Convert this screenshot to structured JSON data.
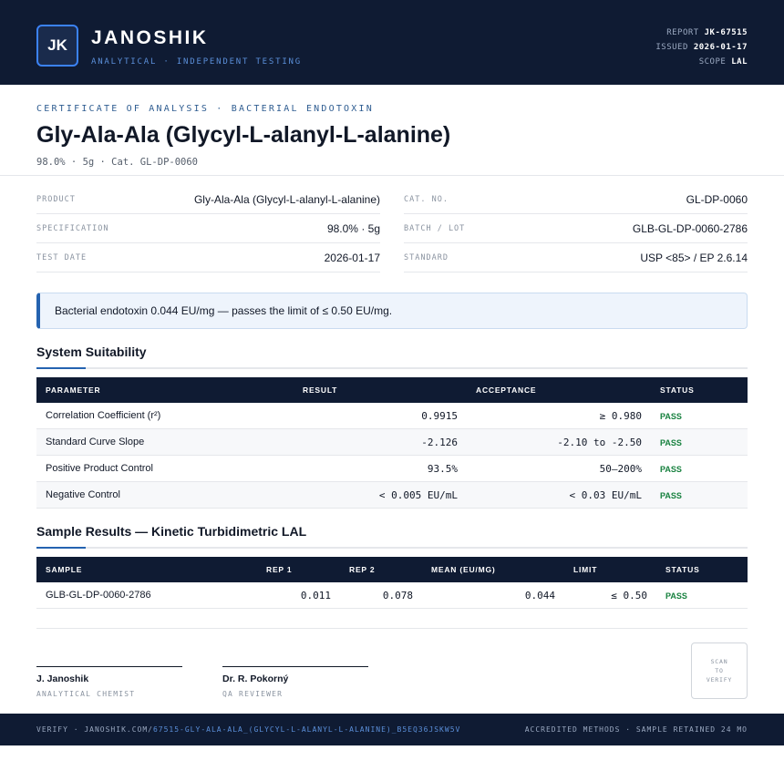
{
  "header": {
    "logo_initials": "JK",
    "brand": "JANOSHIK",
    "tagline": "ANALYTICAL · INDEPENDENT TESTING",
    "report_label": "REPORT",
    "report_value": "JK-67515",
    "issued_label": "ISSUED",
    "issued_value": "2026-01-17",
    "scope_label": "SCOPE",
    "scope_value": "LAL"
  },
  "title_block": {
    "eyebrow": "CERTIFICATE OF ANALYSIS · BACTERIAL ENDOTOXIN",
    "title": "Gly-Ala-Ala (Glycyl-L-alanyl-L-alanine)",
    "subline": "98.0% · 5g  ·  Cat. GL-DP-0060"
  },
  "info": {
    "left": [
      {
        "label": "PRODUCT",
        "value": "Gly-Ala-Ala (Glycyl-L-alanyl-L-alanine)"
      },
      {
        "label": "SPECIFICATION",
        "value": "98.0% · 5g"
      },
      {
        "label": "TEST DATE",
        "value": "2026-01-17"
      }
    ],
    "right": [
      {
        "label": "CAT. NO.",
        "value": "GL-DP-0060"
      },
      {
        "label": "BATCH / LOT",
        "value": "GLB-GL-DP-0060-2786"
      },
      {
        "label": "STANDARD",
        "value": "USP <85> / EP 2.6.14"
      }
    ]
  },
  "callout": {
    "text": "Bacterial endotoxin 0.044 EU/mg — passes the limit of ≤ 0.50 EU/mg."
  },
  "system_suitability": {
    "title": "System Suitability",
    "columns": [
      "PARAMETER",
      "RESULT",
      "ACCEPTANCE",
      "STATUS"
    ],
    "rows": [
      {
        "parameter": "Correlation Coefficient (r²)",
        "result": "0.9915",
        "acceptance": "≥ 0.980",
        "status": "PASS"
      },
      {
        "parameter": "Standard Curve Slope",
        "result": "-2.126",
        "acceptance": "-2.10 to -2.50",
        "status": "PASS"
      },
      {
        "parameter": "Positive Product Control",
        "result": "93.5%",
        "acceptance": "50–200%",
        "status": "PASS"
      },
      {
        "parameter": "Negative Control",
        "result": "< 0.005 EU/mL",
        "acceptance": "< 0.03 EU/mL",
        "status": "PASS"
      }
    ]
  },
  "sample_results": {
    "title": "Sample Results — Kinetic Turbidimetric LAL",
    "columns": [
      "SAMPLE",
      "REP 1",
      "REP 2",
      "MEAN (EU/MG)",
      "LIMIT",
      "STATUS"
    ],
    "rows": [
      {
        "sample": "GLB-GL-DP-0060-2786",
        "rep1": "0.011",
        "rep2": "0.078",
        "mean": "0.044",
        "limit": "≤ 0.50",
        "status": "PASS"
      }
    ]
  },
  "signatures": [
    {
      "name": "J. Janoshik",
      "role": "ANALYTICAL CHEMIST"
    },
    {
      "name": "Dr. R. Pokorný",
      "role": "QA REVIEWER"
    }
  ],
  "qr": {
    "line1": "SCAN",
    "line2": "TO",
    "line3": "VERIFY"
  },
  "footer": {
    "verify_prefix": "VERIFY · JANOSHIK.COM/",
    "verify_link": "67515-GLY-ALA-ALA_(GLYCYL-L-ALANYL-L-ALANINE)_B5EQ36JSKW5V",
    "right": "ACCREDITED METHODS · SAMPLE RETAINED 24 MO"
  },
  "colors": {
    "navy": "#0f1b33",
    "accent": "#2563b0",
    "pass": "#15803d"
  }
}
